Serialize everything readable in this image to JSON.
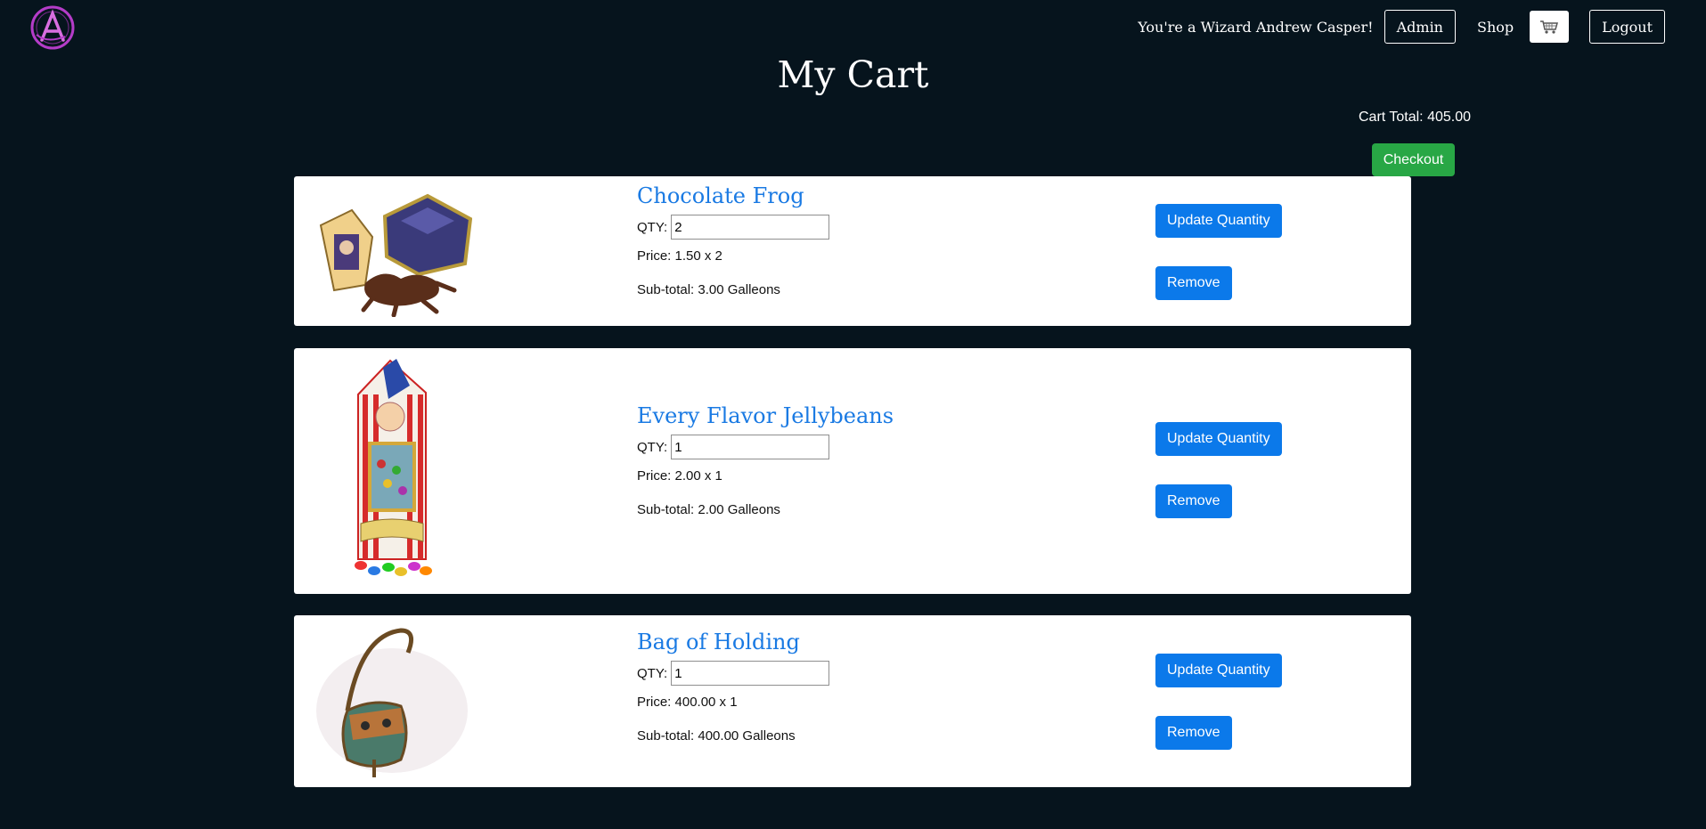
{
  "header": {
    "welcome": "You're a Wizard Andrew Casper!",
    "admin": "Admin",
    "shop": "Shop",
    "logout": "Logout",
    "logo_icon": "wizard-logo-icon",
    "cart_icon": "cart-icon"
  },
  "page": {
    "title": "My Cart",
    "cart_total": "Cart Total: 405.00",
    "checkout": "Checkout"
  },
  "items": [
    {
      "name": "Chocolate Frog",
      "qty_label": "QTY:",
      "qty": "2",
      "price": "Price: 1.50 x 2",
      "subtotal": "Sub-total: 3.00 Galleons",
      "update": "Update Quantity",
      "remove": "Remove"
    },
    {
      "name": "Every Flavor Jellybeans",
      "qty_label": "QTY:",
      "qty": "1",
      "price": "Price: 2.00 x 1",
      "subtotal": "Sub-total: 2.00 Galleons",
      "update": "Update Quantity",
      "remove": "Remove"
    },
    {
      "name": "Bag of Holding",
      "qty_label": "QTY:",
      "qty": "1",
      "price": "Price: 400.00 x 1",
      "subtotal": "Sub-total: 400.00 Galleons",
      "update": "Update Quantity",
      "remove": "Remove"
    }
  ],
  "colors": {
    "background": "#06141d",
    "accent_blue": "#0b79ea",
    "checkout_green": "#28a745",
    "logo_purple": "#b43cc8"
  }
}
